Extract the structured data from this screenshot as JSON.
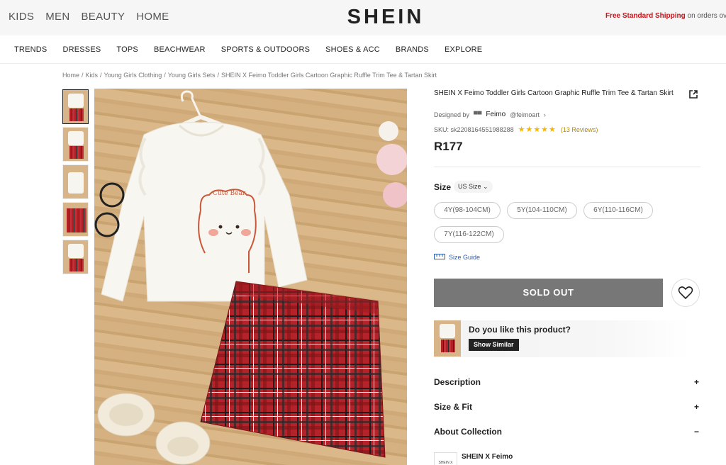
{
  "header": {
    "categories": [
      "KIDS",
      "MEN",
      "BEAUTY",
      "HOME"
    ],
    "logo": "SHEIN",
    "promo_bold": "Free Standard Shipping",
    "promo_rest": " on orders over"
  },
  "nav": {
    "items": [
      "TRENDS",
      "DRESSES",
      "TOPS",
      "BEACHWEAR",
      "SPORTS & OUTDOORS",
      "SHOES & ACC",
      "BRANDS",
      "EXPLORE"
    ]
  },
  "breadcrumb": [
    "Home",
    "Kids",
    "Young Girls Clothing",
    "Young Girls Sets",
    "SHEIN X Feimo Toddler Girls Cartoon Graphic Ruffle Trim Tee & Tartan Skirt"
  ],
  "product": {
    "title": "SHEIN X Feimo Toddler Girls Cartoon Graphic Ruffle Trim Tee & Tartan Skirt",
    "designed_by_label": "Designed by",
    "designer_name": "Feimo",
    "designer_handle": "@feimoart",
    "sku_label": "SKU: sk2208164551988288",
    "rating": 5,
    "reviews": "(13 Reviews)",
    "price": "R177",
    "image_text": "Cute Bear"
  },
  "size": {
    "label": "Size",
    "select": "US Size",
    "options": [
      "4Y(98-104CM)",
      "5Y(104-110CM)",
      "6Y(110-116CM)",
      "7Y(116-122CM)"
    ],
    "guide": "Size Guide"
  },
  "actions": {
    "sold_out": "SOLD OUT",
    "like_question": "Do you like this product?",
    "show_similar": "Show Similar"
  },
  "accordion": [
    {
      "label": "Description",
      "sign": "+"
    },
    {
      "label": "Size & Fit",
      "sign": "+"
    },
    {
      "label": "About Collection",
      "sign": "−"
    }
  ],
  "collection": {
    "name": "SHEIN X Feimo",
    "thumb_text": "SHEIN X"
  },
  "colors": {
    "promo_red": "#c4151c",
    "sold_out_gray": "#777777",
    "star_gold": "#f5b700",
    "link_blue": "#2a5db0",
    "tartan_red": "#b21f24"
  }
}
